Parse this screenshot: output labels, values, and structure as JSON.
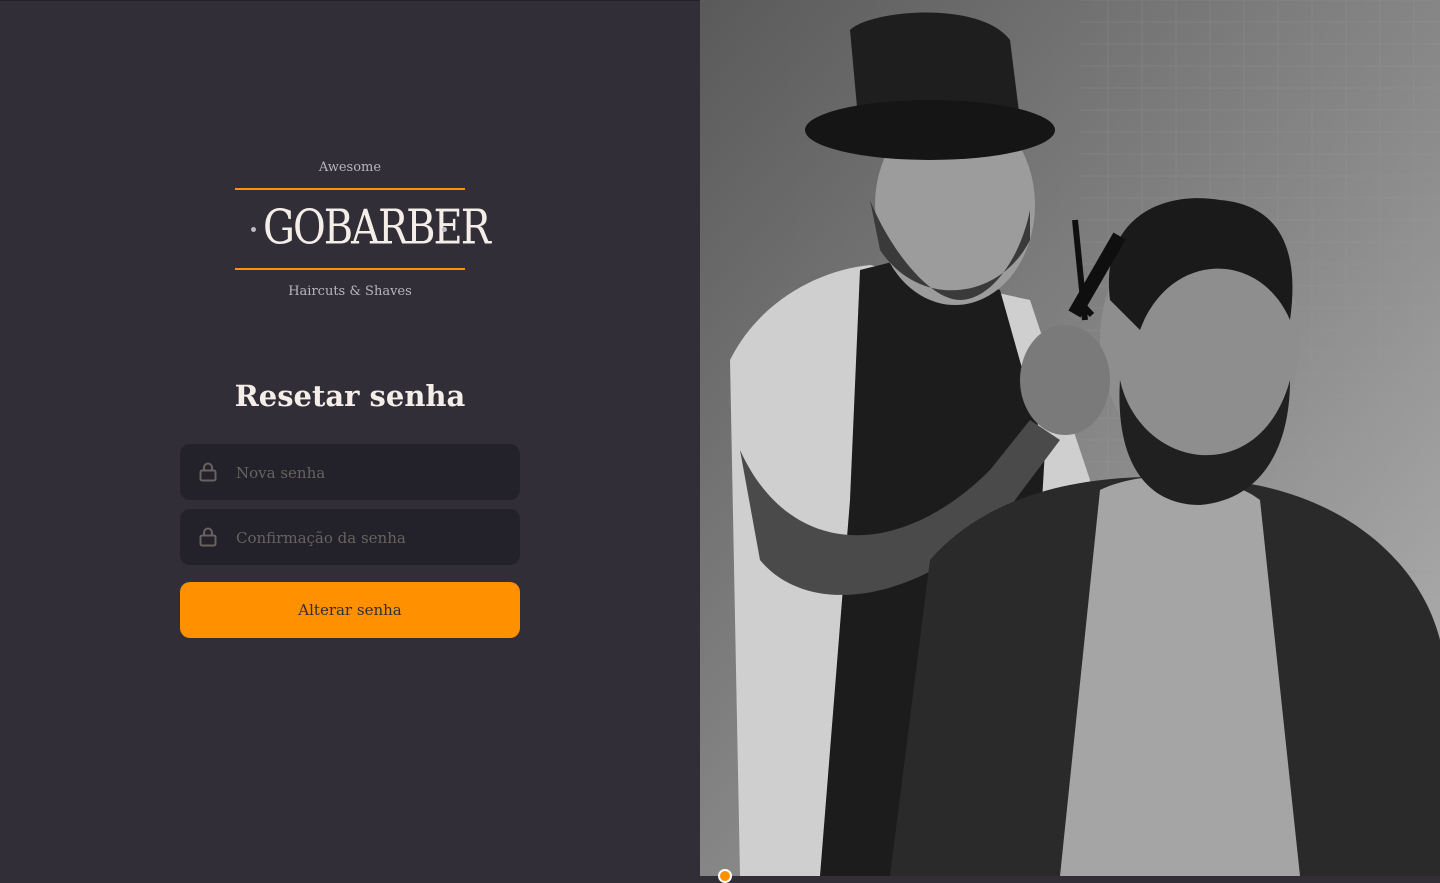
{
  "logo": {
    "top_text": "Awesome",
    "brand": "GOBARBER",
    "bottom_text": "Haircuts & Shaves"
  },
  "form": {
    "title": "Resetar senha",
    "new_password": {
      "placeholder": "Nova senha",
      "value": "",
      "icon": "lock-icon"
    },
    "confirm_password": {
      "placeholder": "Confirmação da senha",
      "value": "",
      "icon": "lock-icon"
    },
    "submit_label": "Alterar senha"
  },
  "colors": {
    "background": "#312e38",
    "input_background": "#232129",
    "accent": "#ff9000",
    "text": "#f4ede8",
    "placeholder": "#666360"
  }
}
